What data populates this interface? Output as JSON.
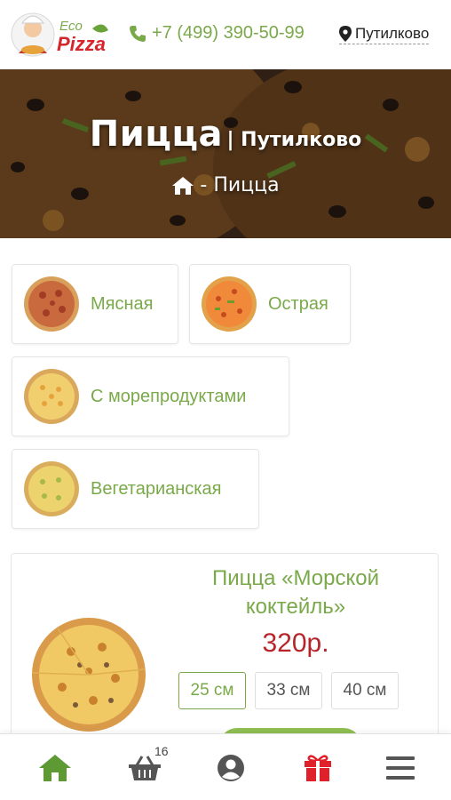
{
  "header": {
    "logo_text_top": "Eco",
    "logo_text_bottom": "Pizza",
    "phone": "+7 (499) 390-50-99",
    "phone_icon": "phone-icon",
    "location": "Путилково",
    "location_icon": "map-marker-icon"
  },
  "hero": {
    "title": "Пицца",
    "subtitle": "| Путилково",
    "breadcrumb_icon": "home-icon",
    "breadcrumb_current": "- Пицца"
  },
  "categories": [
    {
      "label": "Мясная"
    },
    {
      "label": "Острая"
    },
    {
      "label": "С морепродуктами"
    },
    {
      "label": "Вегетарианская"
    }
  ],
  "product": {
    "name": "Пицца «Морской коктейль»",
    "price": "320р.",
    "sizes": [
      "25 см",
      "33 см",
      "40 см"
    ],
    "selected_size": "25 см"
  },
  "bottom_nav": {
    "items": [
      "home-icon",
      "basket-icon",
      "user-icon",
      "gift-icon",
      "menu-icon"
    ],
    "cart_count": "16"
  },
  "colors": {
    "accent": "#7aa94a",
    "price": "#b5252a",
    "gift": "#e0202a"
  }
}
